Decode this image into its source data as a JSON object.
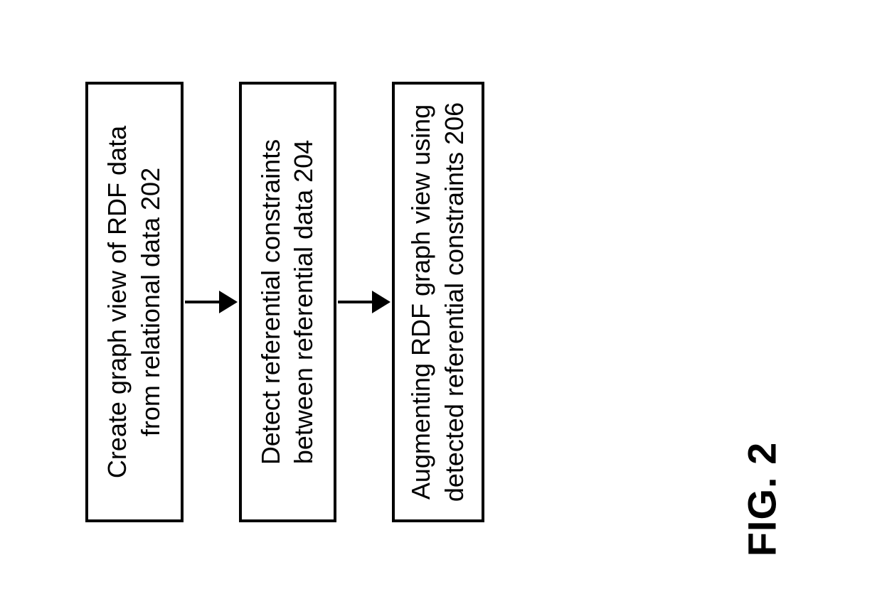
{
  "chart_data": {
    "type": "flowchart",
    "direction": "top-to-bottom-rotated-ccw",
    "nodes": [
      {
        "id": "202",
        "text": "Create graph view of RDF data from relational data 202"
      },
      {
        "id": "204",
        "text": "Detect referential constraints between referential data 204"
      },
      {
        "id": "206",
        "text": "Augmenting RDF graph view using detected referential constraints 206"
      }
    ],
    "edges": [
      {
        "from": "202",
        "to": "204"
      },
      {
        "from": "204",
        "to": "206"
      }
    ]
  },
  "figure_label": "FIG. 2"
}
